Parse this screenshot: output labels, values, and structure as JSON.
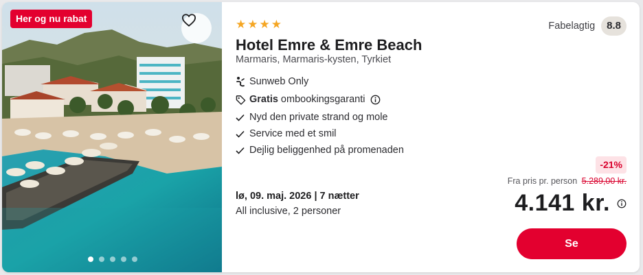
{
  "badge": "Her og nu rabat",
  "hotel": {
    "stars": 4,
    "name": "Hotel Emre & Emre Beach",
    "location": "Marmaris, Marmaris-kysten, Tyrkiet"
  },
  "rating": {
    "label": "Fabelagtig",
    "score": "8.8"
  },
  "features": {
    "sunweb": "Sunweb Only",
    "guarantee_bold": "Gratis",
    "guarantee_text": "ombookingsgaranti",
    "bullets": [
      "Nyd den private strand og mole",
      "Service med et smil",
      "Dejlig beliggenhed på promenaden"
    ]
  },
  "trip": {
    "date": "lø, 09. maj. 2026 | 7 nætter",
    "board": "All inclusive, 2 personer"
  },
  "pricing": {
    "discount": "-21%",
    "from_label": "Fra pris pr. person",
    "old_price": "5.289,00 kr.",
    "price": "4.141 kr."
  },
  "cta_label": "Se",
  "gallery": {
    "slides": 5,
    "active": 1
  },
  "icons": [
    "heart-icon",
    "sunweb-icon",
    "tag-icon",
    "info-icon",
    "check-icon"
  ],
  "colors": {
    "brand_red": "#e3002f",
    "star": "#f5a623",
    "discount_bg": "#fde2e6"
  }
}
